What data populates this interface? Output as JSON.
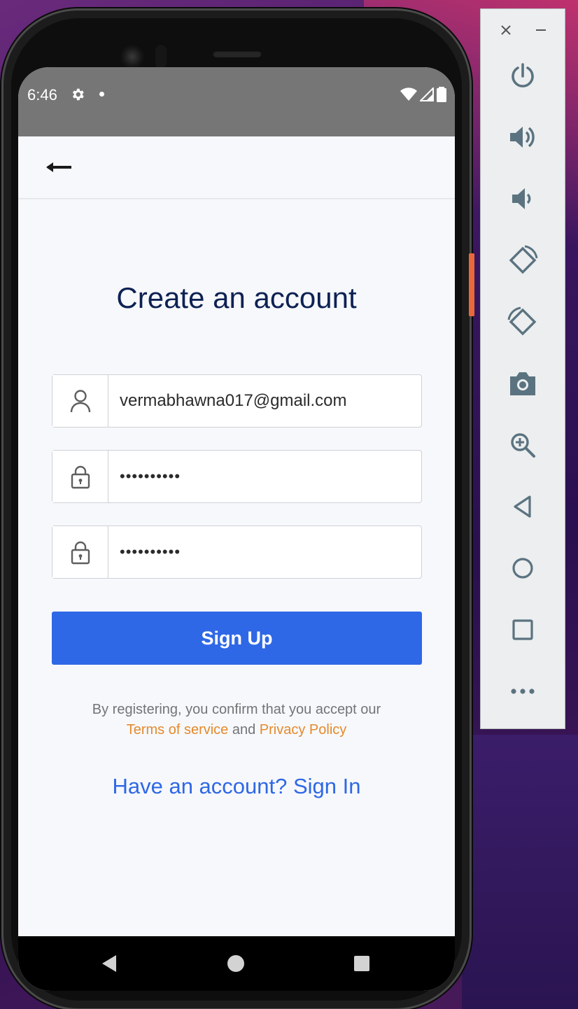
{
  "status_bar": {
    "time": "6:46"
  },
  "page": {
    "title": "Create an account"
  },
  "form": {
    "email_value": "vermabhawna017@gmail.com",
    "password_value": "••••••••••",
    "confirm_password_value": "••••••••••",
    "submit_label": "Sign Up"
  },
  "legal": {
    "prefix": "By registering, you confirm that you accept our",
    "terms_link": "Terms of service",
    "conjunction": "and",
    "privacy_link": "Privacy Policy"
  },
  "footer": {
    "signin_link": "Have an account? Sign In"
  },
  "colors": {
    "primary": "#2e68e6",
    "title": "#0d2153",
    "link_orange": "#e48a2c",
    "screen_bg": "#f7f8fb",
    "status_bar": "#767676"
  },
  "emulator_toolbar": {
    "buttons": [
      "close-icon",
      "minimize-icon",
      "power-icon",
      "volume-up-icon",
      "volume-down-icon",
      "rotate-left-icon",
      "rotate-right-icon",
      "camera-icon",
      "zoom-icon",
      "back-icon",
      "home-icon",
      "overview-icon",
      "more-icon"
    ]
  }
}
